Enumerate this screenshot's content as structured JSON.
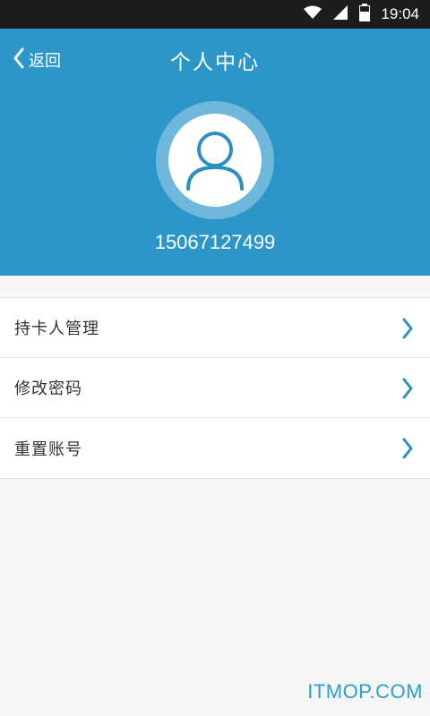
{
  "status_bar": {
    "time": "19:04",
    "icons": [
      "wifi-icon",
      "cell-signal-icon",
      "battery-icon"
    ]
  },
  "header": {
    "back_label": "返回",
    "title": "个人中心",
    "phone": "15067127499",
    "avatar_icon": "user-icon"
  },
  "menu": {
    "items": [
      {
        "label": "持卡人管理",
        "icon": "chevron-right-icon"
      },
      {
        "label": "修改密码",
        "icon": "chevron-right-icon"
      },
      {
        "label": "重置账号",
        "icon": "chevron-right-icon"
      }
    ]
  },
  "watermark": "ITMOP.COM",
  "colors": {
    "header_bg": "#2d96c8",
    "accent": "#2d8fbf",
    "status_bar_bg": "#1d1d1d",
    "page_bg": "#f6f6f6"
  }
}
